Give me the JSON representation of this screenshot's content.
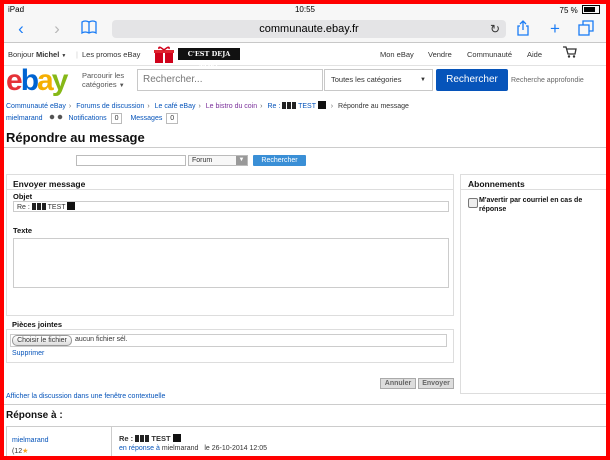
{
  "status_bar": {
    "device": "iPad",
    "time": "10:55",
    "battery": "75 %",
    "battery_level": 0.75
  },
  "browser": {
    "url": "communaute.ebay.fr",
    "icons": [
      "back-icon",
      "forward-icon",
      "bookmarks-icon",
      "reload-icon",
      "share-icon",
      "new-tab-icon",
      "tabs-icon"
    ]
  },
  "topnav": {
    "greeting_prefix": "Bonjour",
    "greeting_name": "Michel",
    "promos": "Les promos eBay",
    "banner": "C'EST DEJA NOEL",
    "my_ebay": "Mon eBay",
    "sell": "Vendre",
    "community": "Communauté",
    "help": "Aide"
  },
  "search": {
    "browse_line1": "Parcourir les",
    "browse_line2": "catégories",
    "placeholder": "Rechercher...",
    "category": "Toutes les catégories",
    "button": "Rechercher",
    "advanced": "Recherche approfondie"
  },
  "breadcrumb": {
    "items": [
      "Communauté eBay",
      "Forums de discussion",
      "Le café eBay",
      "Le bistro du coin"
    ],
    "thread_prefix": "Re :",
    "thread_word": "TEST",
    "current": "Répondre au message"
  },
  "user": {
    "name": "mielmarand",
    "notifications_label": "Notifications",
    "notifications_count": "0",
    "messages_label": "Messages",
    "messages_count": "0"
  },
  "page_title": "Répondre au message",
  "forum_search": {
    "scope": "Forum",
    "button": "Rechercher"
  },
  "compose": {
    "section_title": "Envoyer message",
    "subject_label": "Objet",
    "subject_prefix": "Re :",
    "subject_word": "TEST",
    "text_label": "Texte",
    "attachments_label": "Pièces jointes",
    "choose_file": "Choisir le fichier",
    "no_file": "aucun fichier sél.",
    "remove": "Supprimer",
    "cancel": "Annuler",
    "send": "Envoyer",
    "popup_link": "Afficher la discussion dans une fenêtre contextuelle"
  },
  "subscriptions": {
    "title": "Abonnements",
    "email_notify": "M'avertir par courriel en cas de réponse"
  },
  "reply_to": {
    "title": "Réponse à :",
    "author": "mielmarand",
    "author_score": "(12",
    "subject_prefix": "Re :",
    "subject_word": "TEST",
    "in_reply_to": "en réponse à",
    "reply_user": "mielmarand",
    "date": "le 26-10-2014 12:05"
  },
  "colors": {
    "ebay_red": "#e53238",
    "ebay_blue": "#0064d2",
    "ebay_yellow": "#f5af02",
    "ebay_green": "#86b817",
    "primary_button": "#0654ba",
    "ios_blue": "#1a7cf5"
  }
}
